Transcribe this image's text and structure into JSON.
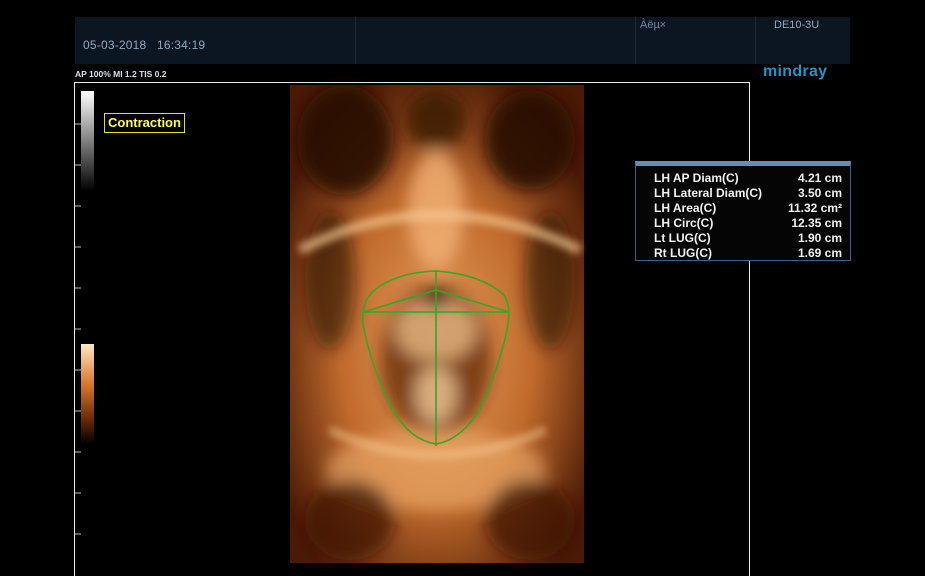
{
  "header": {
    "date": "05-03-2018",
    "time": "16:34:19",
    "user": "Àëµ×",
    "probe": "DE10-3U"
  },
  "params": "AP 100%  MI 1.2  TIS 0.2",
  "brand": "mindray",
  "image_tag": "Contraction",
  "measurements": [
    {
      "label": "LH AP Diam(C)",
      "value": "4.21 cm"
    },
    {
      "label": "LH Lateral Diam(C)",
      "value": "3.50 cm"
    },
    {
      "label": "LH Area(C)",
      "value": "11.32 cm²"
    },
    {
      "label": "LH Circ(C)",
      "value": "12.35 cm"
    },
    {
      "label": "Lt LUG(C)",
      "value": "1.90 cm"
    },
    {
      "label": "Rt LUG(C)",
      "value": "1.69 cm"
    }
  ],
  "colors": {
    "tissue": "#d98a45",
    "trace": "#2faa22",
    "tag": "#ffff40",
    "brand": "#1f97c8"
  }
}
